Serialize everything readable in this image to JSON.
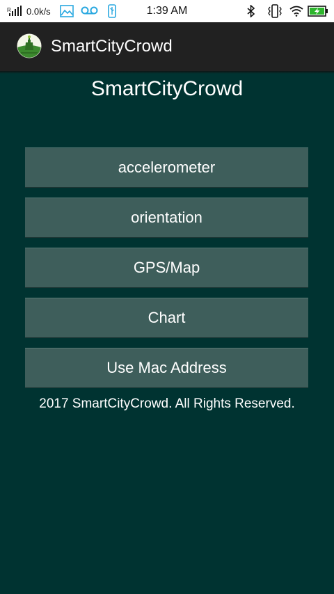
{
  "status_bar": {
    "net_speed": "0.0k/s",
    "time": "1:39 AM",
    "icons": [
      "signal-icon",
      "gallery-icon",
      "voicemail-icon",
      "usb-icon",
      "bluetooth-icon",
      "vibrate-icon",
      "wifi-icon",
      "battery-charging-icon"
    ],
    "battery_level": 1.0,
    "battery_color": "#2db52d"
  },
  "action_bar": {
    "title": "SmartCityCrowd",
    "logo_icon": "app-logo-icon",
    "background": "#212121"
  },
  "main": {
    "title": "SmartCityCrowd",
    "background": "#003331",
    "button_color": "#3e5e5b",
    "buttons": [
      {
        "label": "accelerometer"
      },
      {
        "label": "orientation"
      },
      {
        "label": "GPS/Map"
      },
      {
        "label": "Chart"
      },
      {
        "label": "Use Mac Address"
      }
    ],
    "footer": "2017 SmartCityCrowd. All Rights Reserved."
  }
}
